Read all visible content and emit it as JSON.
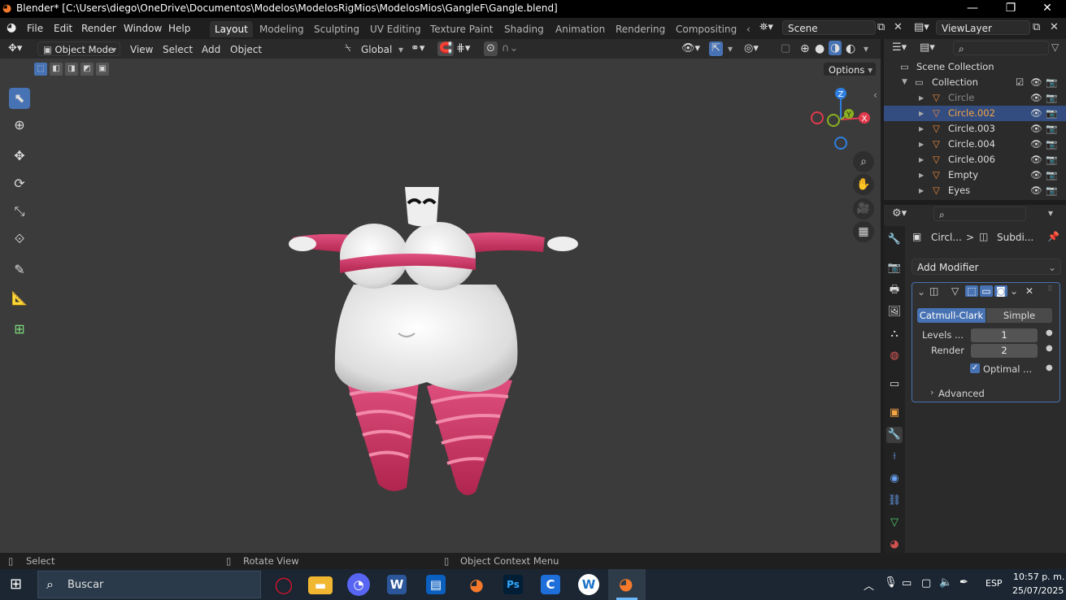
{
  "window": {
    "title": "Blender* [C:\\Users\\diego\\OneDrive\\Documentos\\Modelos\\ModelosRigMios\\ModelosMios\\GangleF\\Gangle.blend]",
    "minimize": "—",
    "maximize": "❐",
    "close": "✕"
  },
  "menubar": {
    "items": [
      "File",
      "Edit",
      "Render",
      "Window",
      "Help"
    ]
  },
  "workspaces": {
    "tabs": [
      "Layout",
      "Modeling",
      "Sculpting",
      "UV Editing",
      "Texture Paint",
      "Shading",
      "Animation",
      "Rendering",
      "Compositing"
    ],
    "active": "Layout",
    "overflow": "‹"
  },
  "scene": {
    "value": "Scene"
  },
  "view_layer": {
    "value": "ViewLayer"
  },
  "viewport_header": {
    "mode": "Object Mode",
    "menus": [
      "View",
      "Select",
      "Add",
      "Object"
    ],
    "orientation": "Global",
    "options": "Options"
  },
  "gizmo": {
    "z": "Z",
    "x": "X",
    "y": "Y"
  },
  "outliner": {
    "search_placeholder": "",
    "root": "Scene Collection",
    "collection": "Collection",
    "rows": [
      {
        "name": "Circle",
        "selected": false,
        "dim": true
      },
      {
        "name": "Circle.002",
        "selected": true,
        "dim": false
      },
      {
        "name": "Circle.003",
        "selected": false,
        "dim": false
      },
      {
        "name": "Circle.004",
        "selected": false,
        "dim": false
      },
      {
        "name": "Circle.006",
        "selected": false,
        "dim": false
      },
      {
        "name": "Empty",
        "selected": false,
        "dim": false
      },
      {
        "name": "Eyes",
        "selected": false,
        "dim": false
      }
    ]
  },
  "properties": {
    "breadcrumb_object": "Circl...",
    "breadcrumb_sep": ">",
    "breadcrumb_modifier": "Subdi...",
    "add_modifier": "Add Modifier",
    "modifier": {
      "mode_catmull": "Catmull-Clark",
      "mode_simple": "Simple",
      "levels_label": "Levels ...",
      "levels_value": "1",
      "render_label": "Render",
      "render_value": "2",
      "optimal_label": "Optimal ...",
      "optimal_checked": true,
      "advanced": "Advanced"
    }
  },
  "statusbar": {
    "select": "Select",
    "rotate": "Rotate View",
    "context": "Object Context Menu"
  },
  "taskbar": {
    "search_placeholder": "Buscar",
    "lang": "ESP",
    "time": "10:57 p. m.",
    "date": "25/07/2025"
  }
}
